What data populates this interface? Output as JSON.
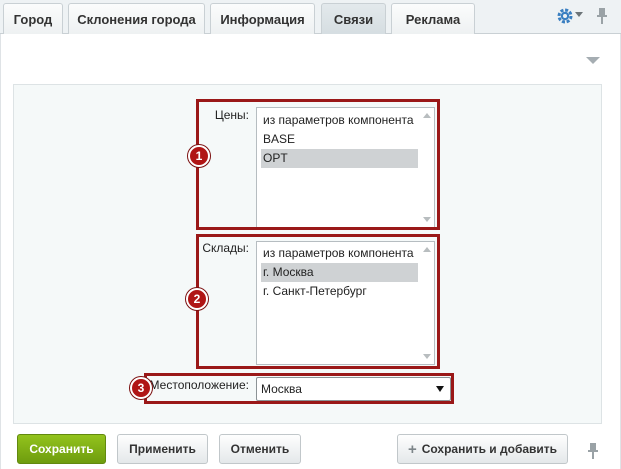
{
  "tabs": [
    {
      "label": "Город",
      "active": false
    },
    {
      "label": "Склонения города",
      "active": false
    },
    {
      "label": "Информация",
      "active": false
    },
    {
      "label": "Связи",
      "active": true
    },
    {
      "label": "Реклама",
      "active": false
    }
  ],
  "icons": {
    "settings": "gear-icon",
    "settings_menu": "chevron-down-icon",
    "pin": "pin-icon",
    "collapse": "collapse-arrow-icon",
    "add": "plus-icon"
  },
  "colors": {
    "accent": "#3a7fc1",
    "highlight": "#9a1818",
    "save_button": "#7fae17"
  },
  "prices": {
    "label": "Цены:",
    "badge": "1",
    "options": [
      {
        "text": "из параметров компонента",
        "selected": false
      },
      {
        "text": "BASE",
        "selected": false
      },
      {
        "text": "OPT",
        "selected": true
      }
    ]
  },
  "warehouses": {
    "label": "Склады:",
    "badge": "2",
    "options": [
      {
        "text": "из параметров компонента",
        "selected": false
      },
      {
        "text": "г. Москва",
        "selected": true
      },
      {
        "text": "г. Санкт-Петербург",
        "selected": false
      }
    ]
  },
  "location": {
    "label": "Местоположение:",
    "badge": "3",
    "value": "Москва"
  },
  "footer": {
    "save": "Сохранить",
    "apply": "Применить",
    "cancel": "Отменить",
    "save_add": "Сохранить и добавить"
  }
}
